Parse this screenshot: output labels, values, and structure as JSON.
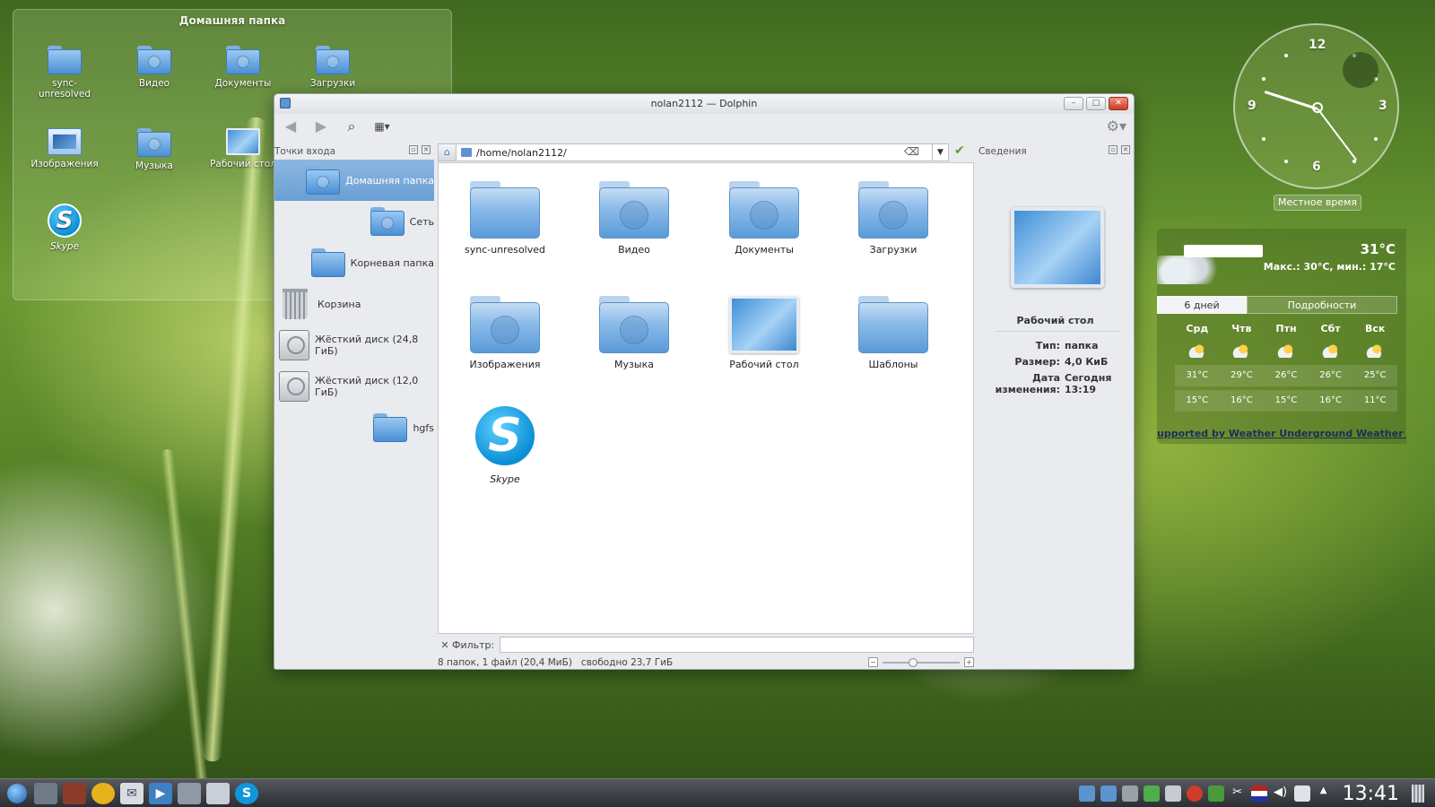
{
  "desktop": {
    "folderview_title": "Домашняя папка",
    "icons": [
      {
        "label": "sync-\nunresolved",
        "icon": "folder-icon"
      },
      {
        "label": "Видео",
        "icon": "folder-video-icon"
      },
      {
        "label": "Документы",
        "icon": "folder-documents-icon"
      },
      {
        "label": "Загрузки",
        "icon": "folder-downloads-icon"
      },
      {
        "label": "Изображения",
        "icon": "folder-images-icon"
      },
      {
        "label": "Музыка",
        "icon": "folder-music-icon"
      },
      {
        "label": "Рабочий стол",
        "icon": "desktop-icon"
      },
      {
        "label": "Skype",
        "icon": "skype-icon"
      }
    ]
  },
  "window": {
    "title": "nolan2112 — Dolphin",
    "buttons": {
      "minimize": "–",
      "maximize": "□",
      "close": "✕"
    }
  },
  "places": {
    "title": "Точки входа",
    "items": [
      {
        "label": "Домашняя папка",
        "icon": "home-folder-icon"
      },
      {
        "label": "Сеть",
        "icon": "network-folder-icon"
      },
      {
        "label": "Корневая папка",
        "icon": "root-folder-icon"
      },
      {
        "label": "Корзина",
        "icon": "trash-icon"
      },
      {
        "label": "Жёсткий диск (24,8 ГиБ)",
        "icon": "hard-disk-icon"
      },
      {
        "label": "Жёсткий диск (12,0 ГиБ)",
        "icon": "hard-disk-icon"
      },
      {
        "label": "hgfs",
        "icon": "folder-icon"
      }
    ]
  },
  "location": {
    "path": "/home/nolan2112/"
  },
  "files": [
    {
      "label": "sync-unresolved",
      "icon": "folder-icon"
    },
    {
      "label": "Видео",
      "icon": "folder-video-icon"
    },
    {
      "label": "Документы",
      "icon": "folder-documents-icon"
    },
    {
      "label": "Загрузки",
      "icon": "folder-downloads-icon"
    },
    {
      "label": "Изображения",
      "icon": "folder-images-icon"
    },
    {
      "label": "Музыка",
      "icon": "folder-music-icon"
    },
    {
      "label": "Рабочий стол",
      "icon": "desktop-icon"
    },
    {
      "label": "Шаблоны",
      "icon": "folder-templates-icon"
    },
    {
      "label": "Skype",
      "icon": "skype-icon"
    }
  ],
  "info": {
    "title": "Сведения",
    "name": "Рабочий стол",
    "type_key": "Тип:",
    "type_val": "папка",
    "size_key": "Размер:",
    "size_val": "4,0 КиБ",
    "date_key1": "Дата",
    "date_key2": "изменения:",
    "date_val1": "Сегодня",
    "date_val2": "13:19"
  },
  "filter": {
    "label": "Фильтр:",
    "value": ""
  },
  "status": {
    "text": "8 папок, 1 файл (20,4 МиБ)   свободно 23,7 ГиБ",
    "zoom_level": 0.4
  },
  "clock": {
    "label": "Местное время",
    "numbers": [
      "12",
      "3",
      "6",
      "9"
    ]
  },
  "weather": {
    "temp": "31°C",
    "minmax": "Макс.: 30°C, мин.: 17°C",
    "tab_days": "6 дней",
    "tab_details": "Подробности",
    "days": [
      {
        "name": "Срд",
        "high": "31°C",
        "low": "15°C"
      },
      {
        "name": "Чтв",
        "high": "29°C",
        "low": "16°C"
      },
      {
        "name": "Птн",
        "high": "26°C",
        "low": "15°C"
      },
      {
        "name": "Сбт",
        "high": "26°C",
        "low": "16°C"
      },
      {
        "name": "Вск",
        "high": "25°C",
        "low": "11°C"
      }
    ],
    "credit": "upported by Weather Underground Weather Station"
  },
  "taskbar": {
    "time": "13:41"
  },
  "colors": {
    "accent": "#6a9fd3",
    "close": "#c83b24"
  }
}
